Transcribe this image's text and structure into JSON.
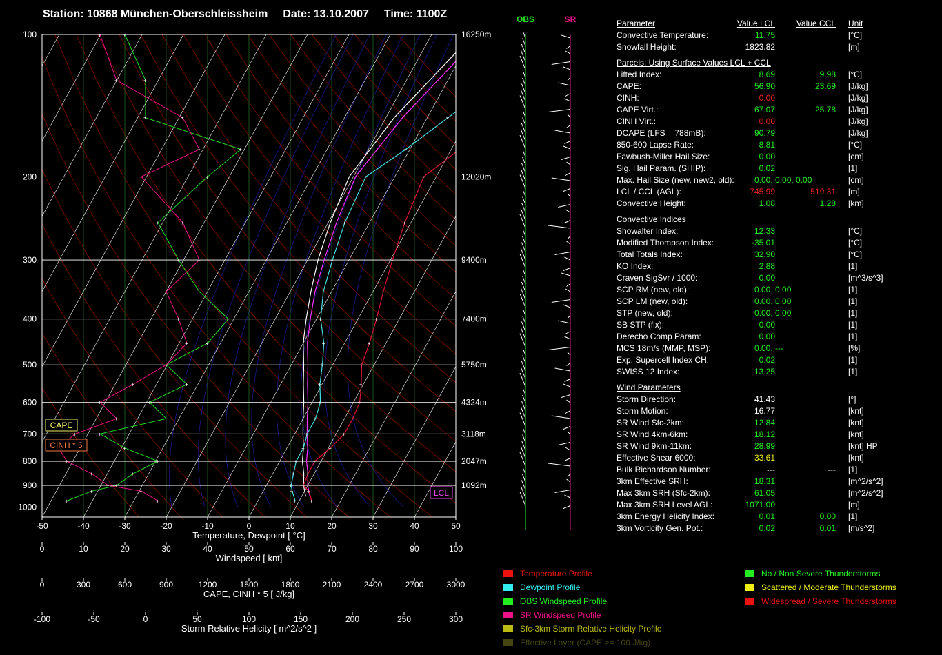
{
  "header": {
    "station": "Station: 10868 München-Oberschleissheim",
    "date": "Date: 13.10.2007",
    "time": "Time: 1100Z"
  },
  "colors": {
    "temperature": "#dd1133",
    "dewpoint": "#44e0e0",
    "obs_wind": "#22dd22",
    "sr_wind": "#ee1188",
    "helicity": "#bbbb22",
    "effective_layer": "#444422",
    "good": "#22ee22",
    "bad": "#ee2222",
    "warn": "#eeee22"
  },
  "chart_data": {
    "type": "line",
    "xlabel": "Temperature, Dewpoint  [ °C]",
    "x_ticks": [
      "-50",
      "-40",
      "-30",
      "-20",
      "-10",
      "0",
      "10",
      "20",
      "30",
      "40",
      "50"
    ],
    "xlim": [
      -50,
      50
    ],
    "y_ticks": [
      "100",
      "200",
      "300",
      "400",
      "500",
      "600",
      "700",
      "800",
      "900",
      "1000"
    ],
    "ylim": [
      1050,
      100
    ],
    "height_labels": [
      {
        "p": 100,
        "label": "16250m"
      },
      {
        "p": 200,
        "label": "12020m"
      },
      {
        "p": 300,
        "label": "9400m"
      },
      {
        "p": 400,
        "label": "7400m"
      },
      {
        "p": 500,
        "label": "5750m"
      },
      {
        "p": 600,
        "label": "4324m"
      },
      {
        "p": 700,
        "label": "3118m"
      },
      {
        "p": 800,
        "label": "2047m"
      },
      {
        "p": 900,
        "label": "1092m"
      }
    ],
    "axes2": [
      {
        "label": "Windspeed  [ knt]",
        "ticks": [
          "0",
          "10",
          "20",
          "30",
          "40",
          "50",
          "60",
          "70",
          "80",
          "90",
          "100"
        ]
      },
      {
        "label": "CAPE, CINH * 5  [ J/kg]",
        "ticks": [
          "0",
          "300",
          "600",
          "900",
          "1200",
          "1500",
          "1800",
          "2100",
          "2400",
          "2700",
          "3000"
        ]
      },
      {
        "label": "Storm Relative Helicity  [ m^2/s^2 ]",
        "ticks": [
          "-100",
          "-50",
          "0",
          "50",
          "100",
          "150",
          "200",
          "250",
          "300"
        ]
      }
    ],
    "boxes": {
      "cape": "CAPE",
      "cinh": "CINH * 5",
      "lcl": "LCL"
    },
    "temperature": {
      "p": [
        970,
        925,
        900,
        850,
        800,
        750,
        700,
        650,
        600,
        550,
        500,
        450,
        400,
        350,
        300,
        250,
        200,
        175,
        150,
        125,
        100
      ],
      "t": [
        13,
        11,
        9,
        8.5,
        8.5,
        10.5,
        12,
        12,
        11.5,
        9.5,
        7,
        6,
        4.5,
        2.5,
        0.5,
        -1.5,
        -3,
        2,
        10,
        22,
        35
      ]
    },
    "dewpoint": {
      "p": [
        970,
        925,
        900,
        850,
        800,
        750,
        700,
        650,
        600,
        550,
        500,
        450,
        400,
        350,
        300,
        250,
        200,
        175,
        150,
        125,
        100
      ],
      "t": [
        9,
        7,
        6,
        5,
        4,
        4,
        3,
        3,
        2,
        -0.5,
        -2.5,
        -5,
        -9,
        -12,
        -14,
        -16,
        -17,
        -11,
        -5,
        2,
        12
      ]
    },
    "obs_wind": {
      "p": [
        970,
        925,
        900,
        850,
        800,
        750,
        700,
        650,
        600,
        550,
        500,
        450,
        400,
        350,
        300,
        250,
        200,
        175,
        150,
        125,
        100
      ],
      "kt": [
        6,
        12,
        18,
        22,
        28,
        20,
        14,
        30,
        26,
        35,
        30,
        40,
        45,
        38,
        33,
        28,
        40,
        48,
        25,
        25,
        20
      ]
    },
    "sr_wind": {
      "p": [
        970,
        925,
        900,
        850,
        800,
        750,
        700,
        650,
        600,
        550,
        500,
        450,
        400,
        350,
        300,
        250,
        200,
        175,
        150,
        125,
        100
      ],
      "kt": [
        28,
        24,
        16,
        12,
        6,
        4,
        8,
        18,
        14,
        22,
        30,
        35,
        33,
        30,
        38,
        34,
        24,
        38,
        34,
        18,
        14
      ]
    },
    "parcel_lcl": {
      "p": [
        950,
        900,
        850,
        800,
        750,
        700,
        650,
        600,
        550,
        500,
        450,
        400,
        350,
        300,
        250,
        200,
        150,
        100
      ],
      "t": [
        11,
        9,
        7.5,
        5.5,
        4,
        2,
        0,
        -2,
        -4.5,
        -7,
        -10,
        -12.5,
        -15,
        -17.5,
        -19.5,
        -21,
        -18,
        -10
      ]
    },
    "parcel_ccl": {
      "p": [
        950,
        900,
        850,
        800,
        750,
        700,
        650,
        600,
        550,
        500,
        450,
        400,
        350,
        300,
        250,
        200,
        150,
        100
      ],
      "t": [
        12,
        10,
        8.5,
        6.5,
        5,
        3,
        1,
        -1,
        -3.5,
        -6,
        -9,
        -11.5,
        -14,
        -16,
        -18,
        -19.5,
        -16,
        -8
      ]
    }
  },
  "hodo": {
    "obs_label": "OBS",
    "sr_label": "SR"
  },
  "params": {
    "header": {
      "parameter": "Parameter",
      "lcl": "Value LCL",
      "ccl": "Value CCL",
      "unit": "Unit"
    },
    "rows": [
      {
        "label": "Convective Temperature:",
        "v1": "11.75",
        "c1": "good",
        "v2": "",
        "unit": "[°C]"
      },
      {
        "label": "Snowfall Height:",
        "v1": "1823.82",
        "c1": "white",
        "v2": "",
        "unit": "[m]"
      },
      {
        "gap": true
      },
      {
        "section": "Parcels: Using Surface Values LCL + CCL"
      },
      {
        "label": "Lifted Index:",
        "v1": "8.69",
        "c1": "good",
        "v2": "9.98",
        "c2": "good",
        "unit": "[°C]"
      },
      {
        "label": "CAPE:",
        "v1": "56.90",
        "c1": "good",
        "v2": "23.69",
        "c2": "good",
        "unit": "[J/kg]"
      },
      {
        "label": "CINH:",
        "v1": "0.00",
        "c1": "bad",
        "v2": "",
        "unit": "[J/kg]"
      },
      {
        "label": "CAPE Virt.:",
        "v1": "67.07",
        "c1": "good",
        "v2": "25.78",
        "c2": "good",
        "unit": "[J/kg]"
      },
      {
        "label": "CINH Virt.:",
        "v1": "0.00",
        "c1": "bad",
        "v2": "",
        "unit": "[J/kg]"
      },
      {
        "label": "DCAPE (LFS = 788mB):",
        "v1": "90.79",
        "c1": "good",
        "v2": "",
        "unit": "[J/kg]"
      },
      {
        "label": "850-600 Lapse Rate:",
        "v1": "8.81",
        "c1": "good",
        "v2": "",
        "unit": "[°C]"
      },
      {
        "label": "Fawbush-Miller Hail Size:",
        "v1": "0.00",
        "c1": "good",
        "v2": "",
        "unit": "[cm]"
      },
      {
        "label": "Sig. Hail Param. (SHIP):",
        "v1": "0.02",
        "c1": "good",
        "v2": "",
        "unit": "[1]"
      },
      {
        "label": "Max. Hail Size (new, new2, old):",
        "v1": "0.00,  0.00,  0.00",
        "c1": "good",
        "v2": "",
        "unit": "[cm]",
        "wide": true
      },
      {
        "label": "LCL / CCL (AGL):",
        "v1": "745.99",
        "c1": "bad",
        "v2": "519.31",
        "c2": "bad",
        "unit": "[m]"
      },
      {
        "label": "Convective Height:",
        "v1": "1.08",
        "c1": "good",
        "v2": "1.28",
        "c2": "good",
        "unit": "[km]"
      },
      {
        "gap": true
      },
      {
        "section": "Convective Indices"
      },
      {
        "label": "Showalter Index:",
        "v1": "12.33",
        "c1": "good",
        "v2": "",
        "unit": "[°C]"
      },
      {
        "label": "Modified Thompson Index:",
        "v1": "-35.01",
        "c1": "good",
        "v2": "",
        "unit": "[°C]"
      },
      {
        "label": "Total Totals Index:",
        "v1": "32.90",
        "c1": "good",
        "v2": "",
        "unit": "[°C]"
      },
      {
        "label": "KO Index:",
        "v1": "2.88",
        "c1": "good",
        "v2": "",
        "unit": "[1]"
      },
      {
        "label": "Craven SigSvr / 1000:",
        "v1": "0.00",
        "c1": "good",
        "v2": "",
        "unit": "[m^3/s^3]"
      },
      {
        "label": "SCP RM (new, old):",
        "v1": "0.00,  0.00",
        "c1": "good",
        "v2": "",
        "unit": "[1]",
        "wide": true
      },
      {
        "label": "SCP LM (new, old):",
        "v1": "0.00,  0.00",
        "c1": "good",
        "v2": "",
        "unit": "[1]",
        "wide": true
      },
      {
        "label": "STP (new, old):",
        "v1": "0.00,  0.00",
        "c1": "good",
        "v2": "",
        "unit": "[1]",
        "wide": true
      },
      {
        "label": "SB STP (fix):",
        "v1": "0.00",
        "c1": "good",
        "v2": "",
        "unit": "[1]"
      },
      {
        "label": "Derecho Comp Param:",
        "v1": "0.00",
        "c1": "good",
        "v2": "",
        "unit": "[1]"
      },
      {
        "label": "MCS 18m/s (MMP, MSP):",
        "v1": "0.00,  ---",
        "c1": "good",
        "v2": "",
        "unit": "[%]",
        "wide": true
      },
      {
        "label": "Exp. Supercell Index CH:",
        "v1": "0.02",
        "c1": "good",
        "v2": "",
        "unit": "[1]"
      },
      {
        "label": "SWISS 12 Index:",
        "v1": "13.25",
        "c1": "good",
        "v2": "",
        "unit": "[1]"
      },
      {
        "gap": true
      },
      {
        "section": "Wind Parameters"
      },
      {
        "label": "Storm Direction:",
        "v1": "41.43",
        "c1": "white",
        "v2": "",
        "unit": "[°]"
      },
      {
        "label": "Storm Motion:",
        "v1": "16.77",
        "c1": "white",
        "v2": "",
        "unit": "[knt]"
      },
      {
        "label": "SR Wind Sfc-2km:",
        "v1": "12.84",
        "c1": "good",
        "v2": "",
        "unit": "[knt]"
      },
      {
        "label": "SR Wind 4km-6km:",
        "v1": "18.12",
        "c1": "good",
        "v2": "",
        "unit": "[knt]"
      },
      {
        "label": "SR Wind 9km-11km:",
        "v1": "28.99",
        "c1": "good",
        "v2": "",
        "unit": "[knt] HP"
      },
      {
        "label": "Effective Shear 6000:",
        "v1": "33.61",
        "c1": "warn",
        "v2": "",
        "unit": "[knt]"
      },
      {
        "label": "Bulk Richardson Number:",
        "v1": "---",
        "c1": "white",
        "v2": "---",
        "c2": "white",
        "unit": "[1]"
      },
      {
        "label": "3km Effective SRH:",
        "v1": "18.31",
        "c1": "good",
        "v2": "",
        "unit": "[m^2/s^2]"
      },
      {
        "label": "Max 3km SRH (Sfc-2km):",
        "v1": "61.05",
        "c1": "good",
        "v2": "",
        "unit": "[m^2/s^2]"
      },
      {
        "label": "Max 3km SRH Level AGL:",
        "v1": "1071.00",
        "c1": "good",
        "v2": "",
        "unit": "[m]"
      },
      {
        "label": "3km Energy Helicity Index:",
        "v1": "0.01",
        "c1": "good",
        "v2": "0.00",
        "c2": "good",
        "unit": "[1]"
      },
      {
        "label": "3km Vorticity Gen. Pot.:",
        "v1": "0.02",
        "c1": "good",
        "v2": "0.01",
        "c2": "good",
        "unit": "[m/s^2]"
      }
    ]
  },
  "legend_left": [
    {
      "label": "Temperature Profile",
      "color": "#ee1111"
    },
    {
      "label": "Dewpoint Profile",
      "color": "#33eeee"
    },
    {
      "label": "OBS Windspeed Profile",
      "color": "#22ee22"
    },
    {
      "label": "SR Windspeed Profile",
      "color": "#ee1188"
    },
    {
      "label": "Sfc-3km Storm Relative Helicity Profile",
      "color": "#bbbb11"
    },
    {
      "label": "Effective Layer (CAPE >= 100 J/kg)",
      "color": "#444411"
    }
  ],
  "legend_right": [
    {
      "label": "No / Non Severe Thunderstorms",
      "color": "#22ee22"
    },
    {
      "label": "Scattered / Moderate Thunderstorms",
      "color": "#eeee11"
    },
    {
      "label": "Widespread / Severe Thunderstorms",
      "color": "#ee1111"
    }
  ]
}
